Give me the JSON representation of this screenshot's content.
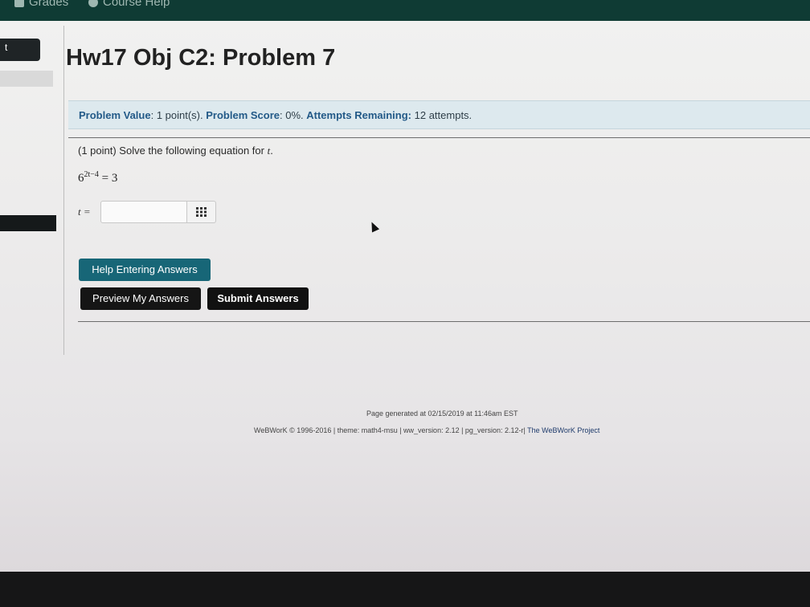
{
  "nav": {
    "grades_label": "Grades",
    "course_help_label": "Course Help"
  },
  "sidebar": {
    "tab_label": "t"
  },
  "problem": {
    "title": "Hw17 Obj C2: Problem 7",
    "info": {
      "value_label": "Problem Value",
      "value_text": ": 1 point(s).",
      "score_label": "Problem Score",
      "score_text": ": 0%.",
      "attempts_label": "Attempts Remaining:",
      "attempts_text": "12 attempts."
    },
    "prompt_text": "(1 point) Solve the following equation for",
    "prompt_var": "t",
    "prompt_end": ".",
    "equation": {
      "base": "6",
      "exponent": "2t−4",
      "rhs": "= 3"
    },
    "answer_label": "t =",
    "answer_value": ""
  },
  "buttons": {
    "help": "Help Entering Answers",
    "preview": "Preview My Answers",
    "submit": "Submit Answers"
  },
  "footer": {
    "generated": "Page generated at 02/15/2019 at 11:46am EST",
    "meta": "WeBWorK © 1996-2016 | theme: math4-msu | ww_version: 2.12 | pg_version: 2.12-r|",
    "project": "The WeBWorK Project"
  }
}
